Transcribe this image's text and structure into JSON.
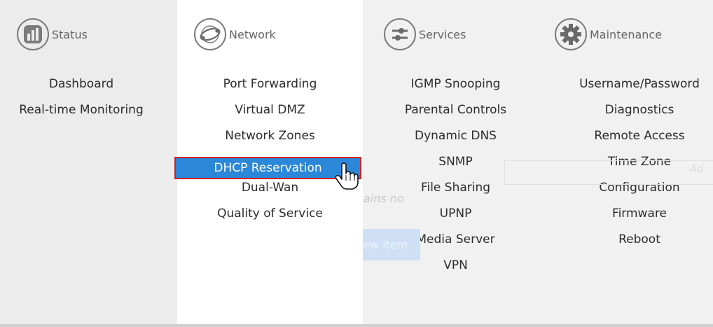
{
  "columns": [
    {
      "title": "Status",
      "icon": "status-bars-icon",
      "items": [
        "Dashboard",
        "Real-time Monitoring"
      ]
    },
    {
      "title": "Network",
      "icon": "network-globe-icon",
      "items": [
        "Port Forwarding",
        "Virtual DMZ",
        "Network Zones",
        "DHCP Reservation",
        "Dual-Wan",
        "Quality of Service"
      ]
    },
    {
      "title": "Services",
      "icon": "services-sliders-icon",
      "items": [
        "IGMP Snooping",
        "Parental Controls",
        "Dynamic DNS",
        "SNMP",
        "File Sharing",
        "UPNP",
        "Media Server",
        "VPN"
      ]
    },
    {
      "title": "Maintenance",
      "icon": "gear-icon",
      "items": [
        "Username/Password",
        "Diagnostics",
        "Remote Access",
        "Time Zone",
        "Configuration",
        "Firmware",
        "Reboot"
      ]
    }
  ],
  "highlighted_item": "DHCP Reservation",
  "background_ghost": {
    "message_fragment": "ains no",
    "button_fragment": "ew Item",
    "add_fragment": "Ad"
  },
  "colors": {
    "menu_bg": "#ececec",
    "highlight_bg": "#2b88d8",
    "highlight_border": "#d02020"
  }
}
